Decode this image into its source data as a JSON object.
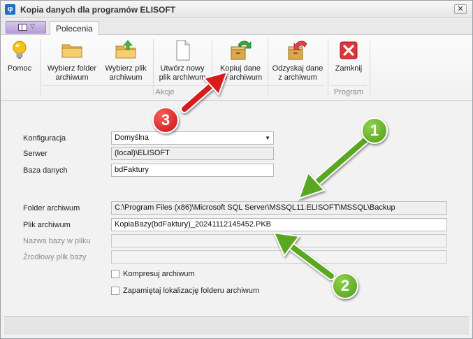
{
  "window": {
    "title": "Kopia danych dla programów ELISOFT",
    "close_glyph": "✕"
  },
  "tabs": [
    {
      "label": "Polecenia"
    }
  ],
  "app_menu": {
    "icon": "app-menu-icon"
  },
  "ribbon": {
    "buttons": [
      {
        "label": "Pomoc",
        "icon": "lightbulb-icon"
      },
      {
        "label": "Wybierz folder\narchiwum",
        "icon": "folder-icon"
      },
      {
        "label": "Wybierz plik\narchiwum",
        "icon": "folder-up-icon"
      },
      {
        "label": "Utwórz nowy\nplik archiwum",
        "icon": "new-file-icon"
      },
      {
        "label": "Kopiuj dane\ndo archiwum",
        "icon": "copy-to-archive-icon"
      },
      {
        "label": "Odzyskaj dane\nz archiwum",
        "icon": "restore-archive-icon"
      },
      {
        "label": "Zamknij",
        "icon": "close-red-icon"
      }
    ],
    "groups": [
      {
        "label": "Akcje"
      },
      {
        "label": "Program"
      }
    ]
  },
  "form": {
    "konfiguracja": {
      "label": "Konfiguracja",
      "value": "Domyślna"
    },
    "serwer": {
      "label": "Serwer",
      "value": "(local)\\ELISOFT"
    },
    "baza": {
      "label": "Baza danych",
      "value": "bdFaktury"
    },
    "folder": {
      "label": "Folder archiwum",
      "value": "C:\\Program Files (x86)\\Microsoft SQL Server\\MSSQL11.ELISOFT\\MSSQL\\Backup"
    },
    "plik": {
      "label": "Plik archiwum",
      "value": "KopiaBazy(bdFaktury)_20241112145452.PKB"
    },
    "nazwa": {
      "label": "Nazwa bazy w pliku",
      "value": ""
    },
    "zrodlowy": {
      "label": "Źrodłowy plik bazy",
      "value": ""
    },
    "kompresuj": {
      "label": "Kompresuj archiwum",
      "checked": false
    },
    "zapamietaj": {
      "label": "Zapamiętaj lokalizację folderu archiwum",
      "checked": false
    }
  },
  "markers": [
    {
      "label": "1"
    },
    {
      "label": "2"
    },
    {
      "label": "3"
    }
  ],
  "colors": {
    "green_marker": "#5aa822",
    "red_marker": "#d81c1c",
    "accent_purple": "#b69bd8"
  }
}
